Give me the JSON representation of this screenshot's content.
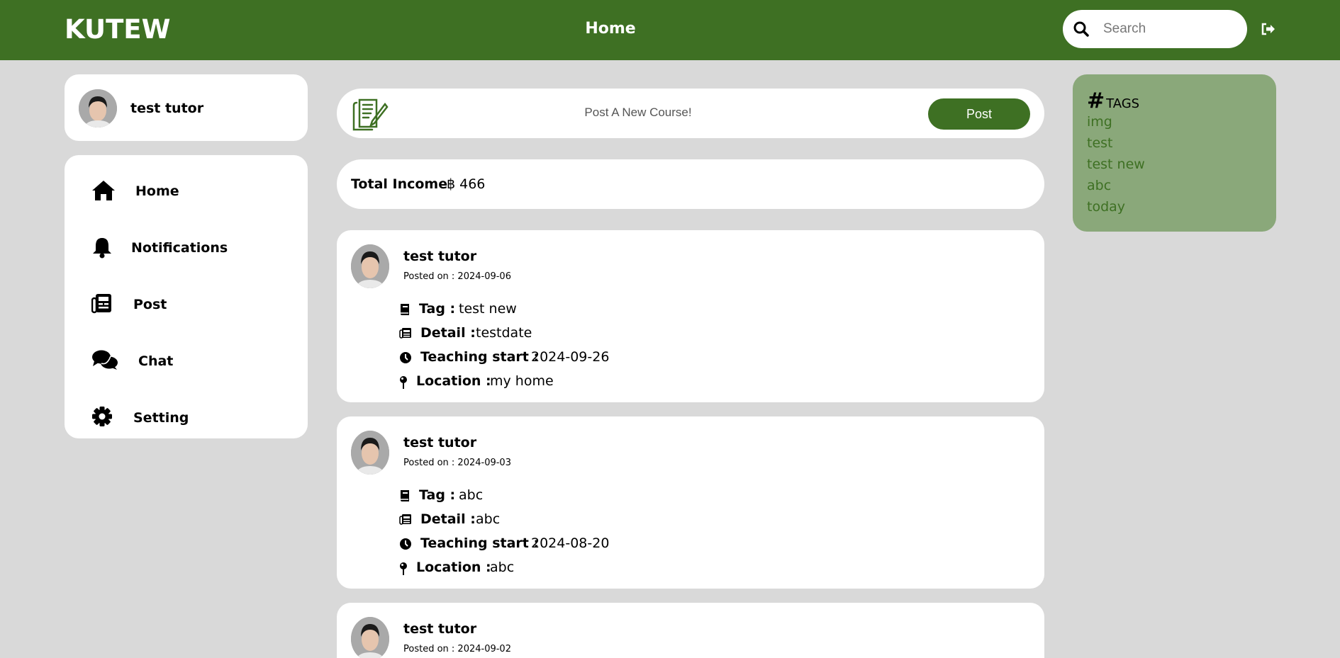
{
  "header": {
    "logo": "KUTEW",
    "title": "Home",
    "search_placeholder": "Search",
    "brand_color": "#3e7023"
  },
  "profile": {
    "name": "test tutor"
  },
  "nav": [
    {
      "label": "Home",
      "icon": "home-icon"
    },
    {
      "label": "Notifications",
      "icon": "bell-icon"
    },
    {
      "label": "Post",
      "icon": "newspaper-icon"
    },
    {
      "label": "Chat",
      "icon": "chat-icon"
    },
    {
      "label": "Setting",
      "icon": "gear-icon"
    }
  ],
  "composer": {
    "placeholder": "Post A New Course!",
    "button": "Post"
  },
  "income": {
    "label": "Total Income",
    "value": "฿ 466"
  },
  "labels": {
    "tag": "Tag :",
    "detail": "Detail :",
    "start": "Teaching start :",
    "location": "Location :"
  },
  "posts": [
    {
      "author": "test tutor",
      "posted": "Posted on : 2024-09-06",
      "tag": "test new",
      "detail": "testdate",
      "start": "2024-09-26",
      "location": "my home"
    },
    {
      "author": "test tutor",
      "posted": "Posted on : 2024-09-03",
      "tag": "abc",
      "detail": "abc",
      "start": "2024-08-20",
      "location": "abc"
    },
    {
      "author": "test tutor",
      "posted": "Posted on : 2024-09-02"
    }
  ],
  "tags": {
    "hash": "#",
    "title": "TAGS",
    "items": [
      "img",
      "test",
      "test new",
      "abc",
      "today"
    ]
  }
}
